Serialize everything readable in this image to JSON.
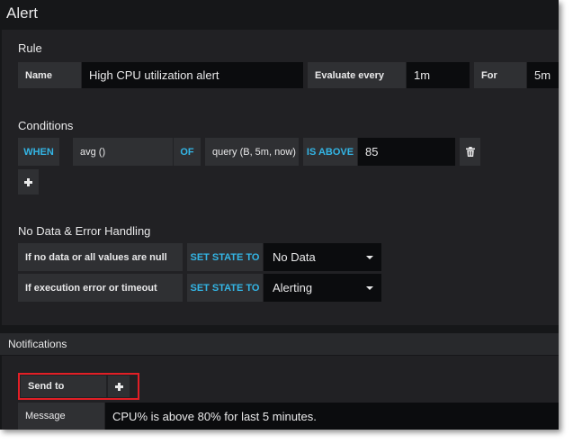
{
  "header": {
    "title": "Alert"
  },
  "rule": {
    "section_title": "Rule",
    "name_label": "Name",
    "name_value": "High CPU utilization alert",
    "evaluate_label": "Evaluate every",
    "evaluate_value": "1m",
    "for_label": "For",
    "for_value": "5m"
  },
  "conditions": {
    "section_title": "Conditions",
    "when_keyword": "WHEN",
    "reducer": "avg ()",
    "of_keyword": "OF",
    "query": "query (B, 5m, now)",
    "evaluator_keyword": "IS ABOVE",
    "threshold": "85",
    "icons": {
      "delete": "trash-icon",
      "add": "plus-icon"
    }
  },
  "no_data": {
    "section_title": "No Data & Error Handling",
    "rows": [
      {
        "label": "If no data or all values are null",
        "keyword": "SET STATE TO",
        "value": "No Data"
      },
      {
        "label": "If execution error or timeout",
        "keyword": "SET STATE TO",
        "value": "Alerting"
      }
    ]
  },
  "notifications": {
    "section_title": "Notifications",
    "send_to_label": "Send to",
    "message_label": "Message",
    "message_value": "CPU% is above 80% for last 5 minutes."
  },
  "colors": {
    "background": "#161719",
    "panel": "#212124",
    "keyword": "#33b5e5",
    "highlight": "#e21f26"
  }
}
